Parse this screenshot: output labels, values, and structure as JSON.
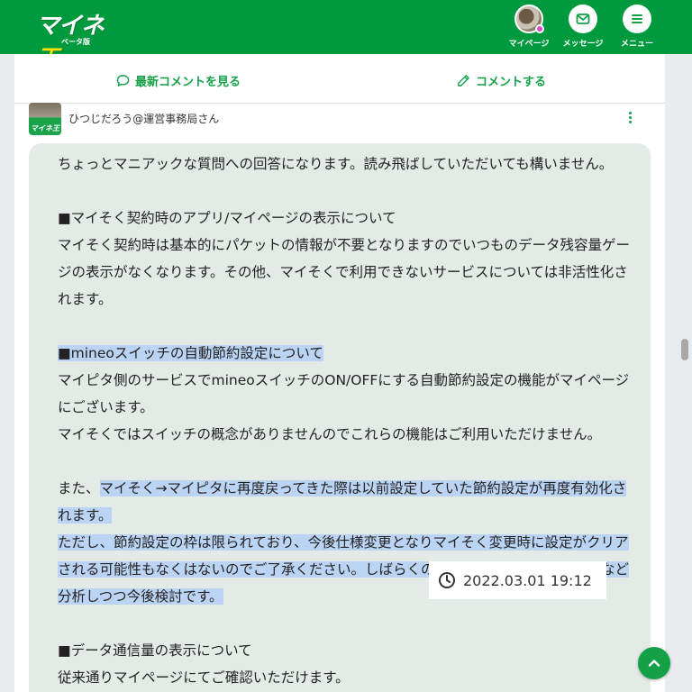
{
  "header": {
    "logo_text_a": "マイネ",
    "logo_text_b": "王",
    "logo_sub": "ベータ版",
    "nav": [
      {
        "label": "マイページ"
      },
      {
        "label": "メッセージ"
      },
      {
        "label": "メニュー"
      }
    ]
  },
  "actions": {
    "latest_comments": "最新コメントを見る",
    "post_comment": "コメントする"
  },
  "comment": {
    "author": "ひつじだろう@運営事務局さん",
    "avatar_text": "マイネ王",
    "lines": [
      "ちょっとマニアックな質問への回答になります。読み飛ばしていただいても構いません。",
      "■マイそく契約時のアプリ/マイページの表示について",
      "マイそく契約時は基本的にパケットの情報が不要となりますのでいつものデータ残容量ゲー",
      "ジの表示がなくなります。その他、マイそくで利用できないサービスについては非活性化さ",
      "れます。",
      "■mineoスイッチの自動節約設定について",
      "マイピタ側のサービスでmineoスイッチのON/OFFにする自動節約設定の機能がマイページ",
      "にございます。",
      "マイそくではスイッチの概念がありませんのでこれらの機能はご利用いただけません。",
      "また、",
      "マイそく→マイピタに再度戻ってきた際は以前設定していた節約設定が再度有効化さ",
      "れます。",
      "ただし、節約設定の枠は限られており、今後仕様変更となりマイそく変更時に設定がクリア",
      "される可能性もなくはないのでご了承ください。しばらくの間は大丈夫です。利用状況など",
      "分析しつつ今後検討です。",
      "■データ通信量の表示について",
      "従来通りマイページにてご確認いただけます。"
    ],
    "timestamp": "2022.03.01 19:12"
  },
  "colors": {
    "brand_green": "#009a3e",
    "accent_green": "#14a047",
    "highlight": "#bcd4f4"
  }
}
